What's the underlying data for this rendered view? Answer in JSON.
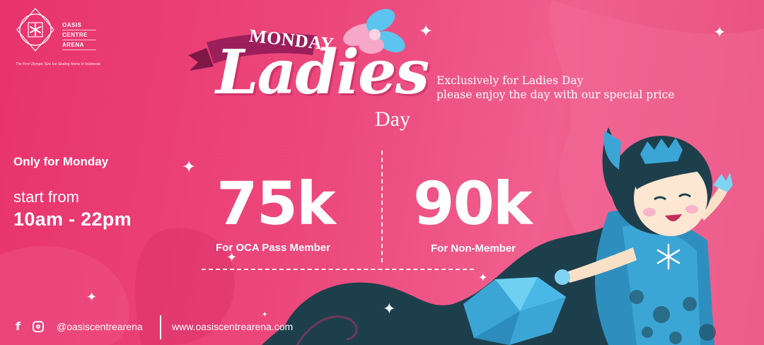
{
  "brand": {
    "name_lines": [
      "OASIS",
      "CENTRE",
      "ARENA"
    ],
    "tagline": "The First Olympic Size Ice Skating Arena In Indonesia",
    "logo_icon": "snowflake-in-diamond-icon"
  },
  "title": {
    "ribbon_text": "MONDAY",
    "main": "Ladies",
    "sub": "Day"
  },
  "subtext": {
    "line1": "Exclusively for Ladies Day",
    "line2": "please enjoy the day with our special price"
  },
  "schedule": {
    "heading": "Only for Monday",
    "start_label": "start from",
    "hours": "10am - 22pm"
  },
  "prices": [
    {
      "amount": "75k",
      "label": "For OCA Pass Member"
    },
    {
      "amount": "90k",
      "label": "For Non-Member"
    }
  ],
  "footer": {
    "social_icons": [
      "facebook-icon",
      "instagram-icon"
    ],
    "handle": "@oasiscentrearena",
    "website": "www.oasiscentrearena.com"
  },
  "colors": {
    "background": "#e8336d",
    "ribbon": "#9c1f5c",
    "hair": "#1d3f4c",
    "dress": "#3ba6d6",
    "flower_pink": "#f7a7c8",
    "flower_blue": "#5cc4ee"
  }
}
